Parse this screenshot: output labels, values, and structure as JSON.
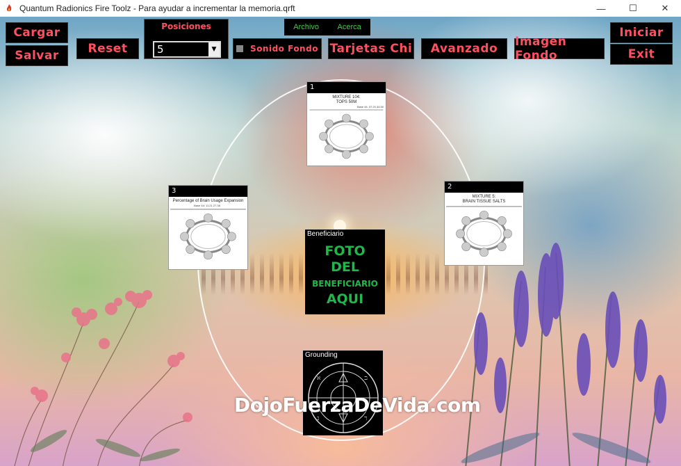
{
  "window": {
    "title": "Quantum Radionics Fire Toolz - Para ayudar a incrementar la memoria.qrft",
    "minimize": "—",
    "maximize": "☐",
    "close": "✕"
  },
  "toolbar": {
    "cargar": "Cargar",
    "salvar": "Salvar",
    "reset": "Reset",
    "posiciones_label": "Posiciones",
    "posiciones_value": "5",
    "sonido_fondo": "Sonido Fondo",
    "tarjetas_chi": "Tarjetas Chi",
    "avanzado": "Avanzado",
    "imagen_fondo": "Imagen Fondo",
    "iniciar": "Iniciar",
    "exit": "Exit"
  },
  "menu": {
    "archivo": "Archivo",
    "acerca": "Acerca"
  },
  "cards": [
    {
      "number": "1",
      "title": "MIXTURE 104:\nTOPS 50M",
      "sub": "Base 44: 37.20.34.50"
    },
    {
      "number": "2",
      "title": "MIXTURE 5:\nBRAIN TISSUE SALTS",
      "sub": ""
    },
    {
      "number": "3",
      "title": "Percentage of Brain Usage Expansion",
      "sub": "Base 44: 11.21.27.38"
    }
  ],
  "beneficiario": {
    "label": "Beneficiario",
    "line1": "FOTO",
    "line2": "DEL",
    "line3": "BENEFICIARIO",
    "line4": "AQUI"
  },
  "grounding": {
    "label": "Grounding"
  },
  "watermark": "DojoFuerzaDeVida.com",
  "colors": {
    "button_text": "#ff4f60",
    "menu_text": "#39d23a",
    "photo_text": "#1fb84a"
  }
}
